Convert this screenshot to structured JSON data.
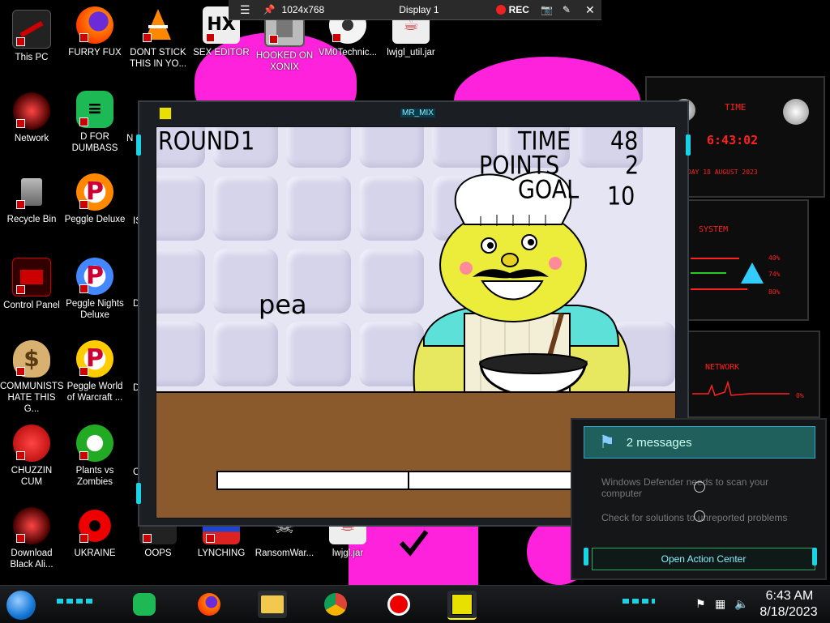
{
  "remote_bar": {
    "resolution": "1024x768",
    "display": "Display 1",
    "rec_label": "REC"
  },
  "desktop_icons": [
    {
      "label": "This PC"
    },
    {
      "label": "FURRY FUX"
    },
    {
      "label": "DONT STICK THIS IN YO..."
    },
    {
      "label": "SEX EDITOR"
    },
    {
      "label": "HOOKED ON XONIX"
    },
    {
      "label": "VM0Technic..."
    },
    {
      "label": "lwjgl_util.jar"
    },
    {
      "label": "Network"
    },
    {
      "label": "D FOR DUMBASS"
    },
    {
      "label": "Recycle Bin"
    },
    {
      "label": "Peggle Deluxe"
    },
    {
      "label": "Control Panel"
    },
    {
      "label": "Peggle Nights Deluxe"
    },
    {
      "label": "COMMUNISTS HATE THIS G..."
    },
    {
      "label": "Peggle World of Warcraft ..."
    },
    {
      "label": "CHUZZIN CUM"
    },
    {
      "label": "Plants vs Zombies"
    },
    {
      "label": "Download Black Ali..."
    },
    {
      "label": "UKRAINE"
    },
    {
      "label": "OOPS"
    },
    {
      "label": "LYNCHING"
    },
    {
      "label": "RansomWar..."
    },
    {
      "label": "lwjgl.jar"
    }
  ],
  "partial_icon_labels": [
    "N",
    "IS",
    "D",
    "D",
    "C"
  ],
  "game": {
    "window_title": "MR_MIX",
    "round_label": "ROUND",
    "round_value": "1",
    "time_label": "TIME",
    "time_value": "48",
    "points_label": "POINTS",
    "points_value": "2",
    "goal_label": "GOAL",
    "goal_value": "10",
    "word": "pea"
  },
  "widgets": {
    "time_title": "TIME",
    "time_value": "6:43:02",
    "date_value": "DAY 18 AUGUST 2023",
    "system_title": "SYSTEM",
    "sys_stats": [
      "40%",
      "74%",
      "80%"
    ],
    "network_title": "NETWORK",
    "net_stat": "0%"
  },
  "action_center": {
    "header": "2 messages",
    "note1": "Windows Defender needs to scan your computer",
    "note2": "Check for solutions to unreported problems",
    "open_button": "Open Action Center"
  },
  "taskbar": {
    "time": "6:43 AM",
    "date": "8/18/2023"
  },
  "colors": {
    "accent_cyan": "#19d4e6",
    "magenta_bg": "#ff22dd",
    "counter_brown": "#8a5a2c",
    "red_hud": "#ff2020"
  }
}
